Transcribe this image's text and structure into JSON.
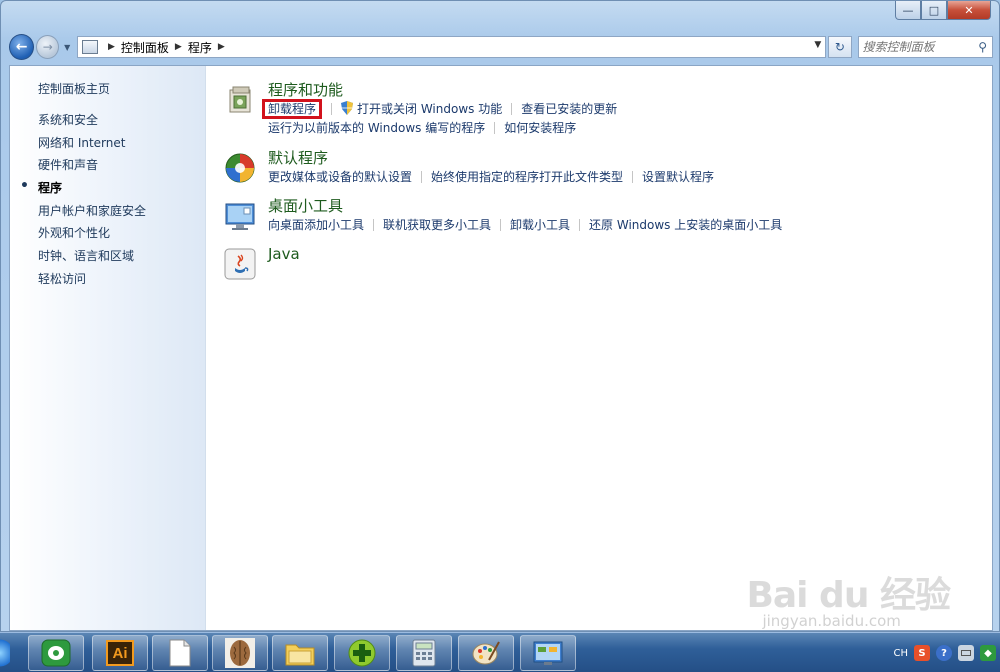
{
  "window": {
    "caption": {
      "minimize": "—",
      "maximize": "□",
      "close": "✕"
    }
  },
  "navigation": {
    "breadcrumbs": [
      "控制面板",
      "程序"
    ],
    "search_placeholder": "搜索控制面板"
  },
  "sidebar": {
    "home": "控制面板主页",
    "items": [
      {
        "label": "系统和安全",
        "current": false
      },
      {
        "label": "网络和 Internet",
        "current": false
      },
      {
        "label": "硬件和声音",
        "current": false
      },
      {
        "label": "程序",
        "current": true
      },
      {
        "label": "用户帐户和家庭安全",
        "current": false
      },
      {
        "label": "外观和个性化",
        "current": false
      },
      {
        "label": "时钟、语言和区域",
        "current": false
      },
      {
        "label": "轻松访问",
        "current": false
      }
    ]
  },
  "categories": [
    {
      "title": "程序和功能",
      "icon": "programs-features-icon",
      "links": [
        {
          "label": "卸载程序",
          "highlighted": true
        },
        {
          "label": "打开或关闭 Windows 功能",
          "shield": true
        },
        {
          "label": "查看已安装的更新"
        },
        {
          "label": "运行为以前版本的 Windows 编写的程序"
        },
        {
          "label": "如何安装程序"
        }
      ]
    },
    {
      "title": "默认程序",
      "icon": "default-programs-icon",
      "links": [
        {
          "label": "更改媒体或设备的默认设置"
        },
        {
          "label": "始终使用指定的程序打开此文件类型"
        },
        {
          "label": "设置默认程序"
        }
      ]
    },
    {
      "title": "桌面小工具",
      "icon": "desktop-gadgets-icon",
      "links": [
        {
          "label": "向桌面添加小工具"
        },
        {
          "label": "联机获取更多小工具"
        },
        {
          "label": "卸载小工具"
        },
        {
          "label": "还原 Windows 上安装的桌面小工具"
        }
      ]
    },
    {
      "title": "Java",
      "icon": "java-icon",
      "links": []
    }
  ],
  "taskbar": {
    "apps": [
      {
        "name": "green-app-icon"
      },
      {
        "name": "illustrator-icon",
        "label": "Ai"
      },
      {
        "name": "blank-document-icon"
      },
      {
        "name": "walnut-image-icon"
      },
      {
        "name": "file-explorer-icon"
      },
      {
        "name": "green-plus-app-icon"
      },
      {
        "name": "calculator-icon"
      },
      {
        "name": "paint-icon"
      },
      {
        "name": "control-panel-icon"
      }
    ],
    "tray": {
      "lang": "CH",
      "ime": "S"
    }
  },
  "watermark": {
    "main": "Bai du 经验",
    "sub": "jingyan.baidu.com"
  },
  "colors": {
    "link": "#1c3a6c",
    "category_title": "#1e5b1e",
    "highlight_border": "#d2121c"
  }
}
